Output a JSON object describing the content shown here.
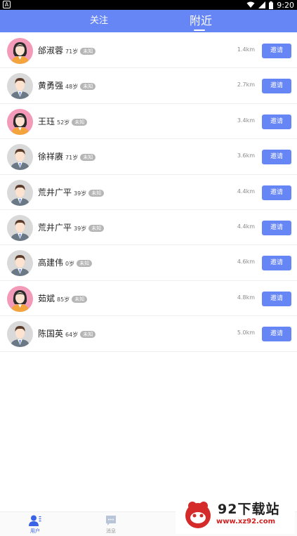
{
  "status_bar": {
    "time": "9:20",
    "app_badge": "A"
  },
  "header": {
    "tabs": [
      {
        "label": "关注",
        "active": false
      },
      {
        "label": "附近",
        "active": true
      }
    ],
    "bg_color": "#6786f5"
  },
  "users": [
    {
      "name": "邰淑蓉",
      "age": "71岁",
      "gender": "未知",
      "distance": "1.4km",
      "invite": "邀请",
      "avatar": "female-avatar"
    },
    {
      "name": "黄勇强",
      "age": "48岁",
      "gender": "未知",
      "distance": "2.7km",
      "invite": "邀请",
      "avatar": "male-avatar"
    },
    {
      "name": "王珏",
      "age": "52岁",
      "gender": "未知",
      "distance": "3.4km",
      "invite": "邀请",
      "avatar": "female-avatar"
    },
    {
      "name": "徐祥赓",
      "age": "71岁",
      "gender": "未知",
      "distance": "3.6km",
      "invite": "邀请",
      "avatar": "male-avatar"
    },
    {
      "name": "荒井广平",
      "age": "39岁",
      "gender": "未知",
      "distance": "4.4km",
      "invite": "邀请",
      "avatar": "male-avatar"
    },
    {
      "name": "荒井广平",
      "age": "39岁",
      "gender": "未知",
      "distance": "4.4km",
      "invite": "邀请",
      "avatar": "male-avatar"
    },
    {
      "name": "高建伟",
      "age": "0岁",
      "gender": "未知",
      "distance": "4.6km",
      "invite": "邀请",
      "avatar": "male-avatar"
    },
    {
      "name": "茹斌",
      "age": "85岁",
      "gender": "未知",
      "distance": "4.8km",
      "invite": "邀请",
      "avatar": "female-avatar"
    },
    {
      "name": "陈国英",
      "age": "64岁",
      "gender": "未知",
      "distance": "5.0km",
      "invite": "邀请",
      "avatar": "male-avatar"
    }
  ],
  "bottom_nav": [
    {
      "label": "用户",
      "icon": "user-icon",
      "active": true
    },
    {
      "label": "消息",
      "icon": "message-icon",
      "active": false
    }
  ],
  "watermark": {
    "title": "92下载站",
    "url": "www.xz92.com"
  },
  "colors": {
    "accent": "#6786f5",
    "badge": "#b5b5b5",
    "female_bg": "#f29ab8",
    "male_bg": "#d9d9d9"
  }
}
